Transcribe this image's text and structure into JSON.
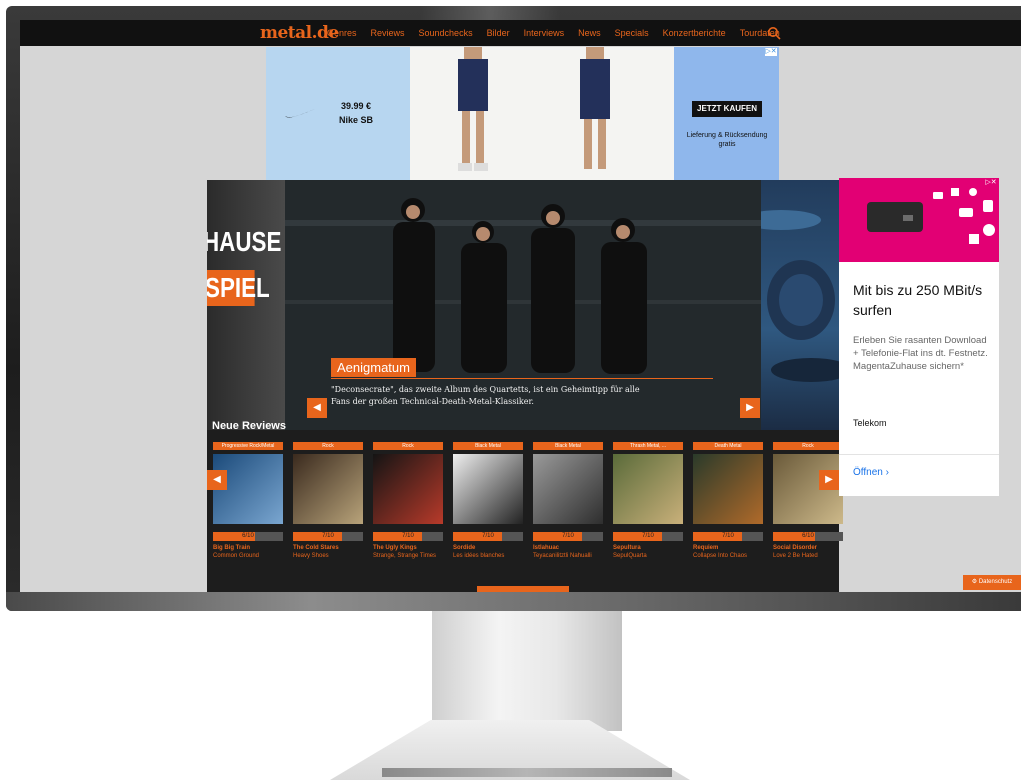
{
  "nav": {
    "logo": "metal.de",
    "links": [
      "Genres",
      "Reviews",
      "Soundchecks",
      "Bilder",
      "Interviews",
      "News",
      "Specials",
      "Konzertberichte",
      "Tourdaten"
    ]
  },
  "ad_top": {
    "price": "39.99 €",
    "product": "Nike SB",
    "cta": "JETZT KAUFEN",
    "shipping": "Lieferung & Rücksendung gratis"
  },
  "side_left": {
    "line1": "HAUSE",
    "line2": "SPIEL"
  },
  "hero": {
    "title": "Aenigmatum",
    "text": "\"Deconsecrate\", das zweite Album des Quartetts, ist ein Geheimtipp für alle Fans der großen Technical-Death-Metal-Klassiker."
  },
  "reviews": {
    "title": "Neue Reviews",
    "cards": [
      {
        "genre": "Progressive Rock/Metal",
        "score": "6/10",
        "score_value": 0.6,
        "band": "Big Big Train",
        "album": "Common Ground",
        "c1": "#1b4a7a",
        "c2": "#7aa6d0"
      },
      {
        "genre": "Rock",
        "score": "7/10",
        "score_value": 0.7,
        "band": "The Cold Stares",
        "album": "Heavy Shoes",
        "c1": "#3a2a1e",
        "c2": "#b8a37a"
      },
      {
        "genre": "Rock",
        "score": "7/10",
        "score_value": 0.7,
        "band": "The Ugly Kings",
        "album": "Strange, Strange Times",
        "c1": "#141414",
        "c2": "#b83a2a"
      },
      {
        "genre": "Black Metal",
        "score": "7/10",
        "score_value": 0.7,
        "band": "Sordide",
        "album": "Les idées blanches",
        "c1": "#efefef",
        "c2": "#222222"
      },
      {
        "genre": "Black Metal",
        "score": "7/10",
        "score_value": 0.7,
        "band": "Istlahuac",
        "album": "Teyacanilitztli Nahualli",
        "c1": "#9a9a9a",
        "c2": "#2e2e2e"
      },
      {
        "genre": "Thrash Metal, ...",
        "score": "7/10",
        "score_value": 0.7,
        "band": "Sepultura",
        "album": "SepulQuarta",
        "c1": "#5a6b3a",
        "c2": "#c9b07a"
      },
      {
        "genre": "Death Metal",
        "score": "7/10",
        "score_value": 0.7,
        "band": "Requiem",
        "album": "Collapse Into Chaos",
        "c1": "#2a3a2a",
        "c2": "#b06a2a"
      },
      {
        "genre": "Rock",
        "score": "6/10",
        "score_value": 0.6,
        "band": "Social Disorder",
        "album": "Love 2 Be Hated",
        "c1": "#6a5a3a",
        "c2": "#cdb98a"
      }
    ]
  },
  "ad_right": {
    "headline": "Mit bis zu 250 MBit/s surfen",
    "body": "Erleben Sie rasanten Download + Telefonie-Flat ins dt. Festnetz. MagentaZuhause sichern*",
    "advertiser": "Telekom",
    "cta": "Öffnen ›"
  },
  "privacy_button": "Datenschutz",
  "colors": {
    "accent": "#e8651c",
    "telekom": "#e20074",
    "link": "#1a73e8"
  }
}
